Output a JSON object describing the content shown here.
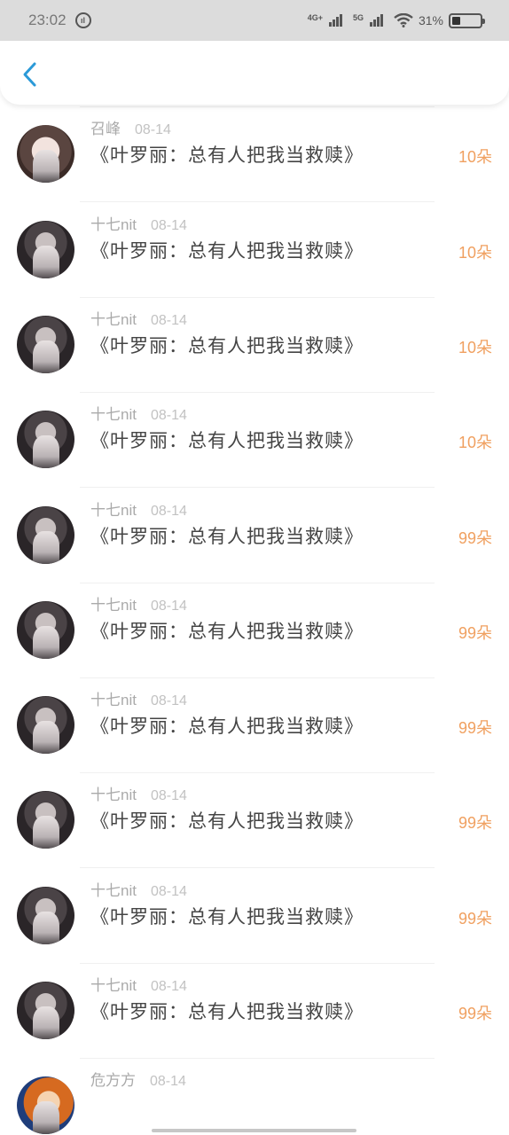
{
  "status_bar": {
    "time": "23:02",
    "net_4g": "4G+",
    "net_5g": "5G",
    "battery_percent": "31%",
    "battery_level": 0.31,
    "icons": [
      "app-notification-icon",
      "signal-4g-icon",
      "signal-5g-icon",
      "wifi-icon",
      "battery-icon"
    ]
  },
  "nav": {
    "back_icon": "chevron-left-icon",
    "accent": "#2b9ad8"
  },
  "colors": {
    "amount": "#f0a060",
    "username": "#aaaaaa",
    "title": "#444444"
  },
  "items": [
    {
      "user": "",
      "date": "",
      "title": "《叶罗丽：总有人把我当救赎》",
      "amount": "10朵",
      "avatar": "anime"
    },
    {
      "user": "召峰",
      "date": "08-14",
      "title": "《叶罗丽：总有人把我当救赎》",
      "amount": "10朵",
      "avatar": "photo"
    },
    {
      "user": "十七nit",
      "date": "08-14",
      "title": "《叶罗丽：总有人把我当救赎》",
      "amount": "10朵",
      "avatar": "anime"
    },
    {
      "user": "十七nit",
      "date": "08-14",
      "title": "《叶罗丽：总有人把我当救赎》",
      "amount": "10朵",
      "avatar": "anime"
    },
    {
      "user": "十七nit",
      "date": "08-14",
      "title": "《叶罗丽：总有人把我当救赎》",
      "amount": "10朵",
      "avatar": "anime"
    },
    {
      "user": "十七nit",
      "date": "08-14",
      "title": "《叶罗丽：总有人把我当救赎》",
      "amount": "99朵",
      "avatar": "anime"
    },
    {
      "user": "十七nit",
      "date": "08-14",
      "title": "《叶罗丽：总有人把我当救赎》",
      "amount": "99朵",
      "avatar": "anime"
    },
    {
      "user": "十七nit",
      "date": "08-14",
      "title": "《叶罗丽：总有人把我当救赎》",
      "amount": "99朵",
      "avatar": "anime"
    },
    {
      "user": "十七nit",
      "date": "08-14",
      "title": "《叶罗丽：总有人把我当救赎》",
      "amount": "99朵",
      "avatar": "anime"
    },
    {
      "user": "十七nit",
      "date": "08-14",
      "title": "《叶罗丽：总有人把我当救赎》",
      "amount": "99朵",
      "avatar": "anime"
    },
    {
      "user": "十七nit",
      "date": "08-14",
      "title": "《叶罗丽：总有人把我当救赎》",
      "amount": "99朵",
      "avatar": "anime"
    },
    {
      "user": "危方方",
      "date": "08-14",
      "title": "",
      "amount": "",
      "avatar": "orange"
    }
  ]
}
